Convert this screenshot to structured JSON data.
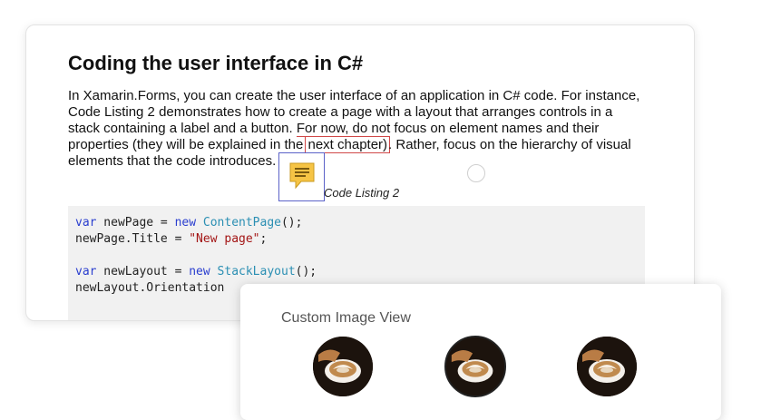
{
  "document": {
    "title": "Coding the user interface in C#",
    "paragraph": {
      "line1": "In Xamarin.Forms, you can create the user interface of an application in C# code. For instance,",
      "line2": "Code Listing 2 demonstrates how to create a page with a layout that arranges controls in a",
      "line3_a": "stack containing a label and a button. ",
      "line3_link": "For now, do not",
      "line3_b": " focus on element names and their",
      "line4_a": "properties (they will be explained in the ",
      "line4_link": "next chapter)",
      "line4_b": ". Rather, focus on the hierarchy of visual",
      "line5": "elements that the code introduces."
    },
    "caption": "Code Listing 2",
    "code": {
      "l1_kw": "var",
      "l1_a": " newPage = ",
      "l1_kw2": "new",
      "l1_sp": " ",
      "l1_ty": "ContentPage",
      "l1_b": "();",
      "l2_a": "newPage.Title = ",
      "l2_str": "\"New page\"",
      "l2_b": ";",
      "l4_kw": "var",
      "l4_a": " newLayout = ",
      "l4_kw2": "new",
      "l4_sp": " ",
      "l4_ty": "StackLayout",
      "l4_b": "();",
      "l5_a": "newLayout.Orientation"
    }
  },
  "custom_image_view": {
    "title": "Custom Image View",
    "images": [
      {
        "name": "latte-art",
        "selected": false
      },
      {
        "name": "latte-art",
        "selected": true
      },
      {
        "name": "latte-art",
        "selected": false
      }
    ]
  },
  "colors": {
    "link_red": "#d04848",
    "comment_yellow": "#f6c445",
    "comment_border": "#5b62c8",
    "code_keyword": "#2a3ecf",
    "code_type": "#2b8fb3",
    "code_string": "#a31515"
  }
}
